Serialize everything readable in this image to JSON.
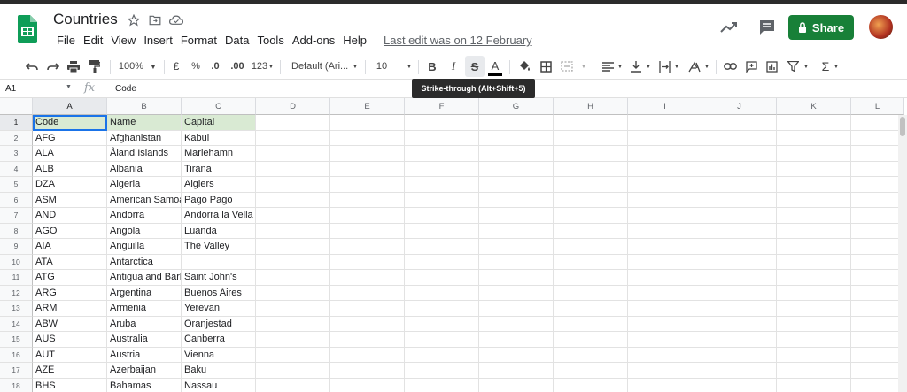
{
  "doc": {
    "title": "Countries"
  },
  "menu": [
    "File",
    "Edit",
    "View",
    "Insert",
    "Format",
    "Data",
    "Tools",
    "Add-ons",
    "Help"
  ],
  "last_edit": "Last edit was on 12 February",
  "share_label": "Share",
  "toolbar": {
    "zoom": "100%",
    "currency": "£",
    "percent": "%",
    "dec_less": ".0",
    "dec_more": ".00",
    "format": "123",
    "font": "Default (Ari...",
    "font_size": "10",
    "bold": "B",
    "italic": "I",
    "strike": "S",
    "textcolor": "A",
    "sigma": "Σ"
  },
  "tooltip": "Strike-through (Alt+Shift+5)",
  "formula_bar": {
    "cell_ref": "A1",
    "fx": "fx",
    "value": "Code"
  },
  "columns": [
    "A",
    "B",
    "C",
    "D",
    "E",
    "F",
    "G",
    "H",
    "I",
    "J",
    "K",
    "L"
  ],
  "rows": [
    [
      "Code",
      "Name",
      "Capital"
    ],
    [
      "AFG",
      "Afghanistan",
      "Kabul"
    ],
    [
      "ALA",
      "Åland Islands",
      "Mariehamn"
    ],
    [
      "ALB",
      "Albania",
      "Tirana"
    ],
    [
      "DZA",
      "Algeria",
      "Algiers"
    ],
    [
      "ASM",
      "American Samoa",
      "Pago Pago"
    ],
    [
      "AND",
      "Andorra",
      "Andorra la Vella"
    ],
    [
      "AGO",
      "Angola",
      "Luanda"
    ],
    [
      "AIA",
      "Anguilla",
      "The Valley"
    ],
    [
      "ATA",
      "Antarctica",
      ""
    ],
    [
      "ATG",
      "Antigua and Barbuda",
      "Saint John's"
    ],
    [
      "ARG",
      "Argentina",
      "Buenos Aires"
    ],
    [
      "ARM",
      "Armenia",
      "Yerevan"
    ],
    [
      "ABW",
      "Aruba",
      "Oranjestad"
    ],
    [
      "AUS",
      "Australia",
      "Canberra"
    ],
    [
      "AUT",
      "Austria",
      "Vienna"
    ],
    [
      "AZE",
      "Azerbaijan",
      "Baku"
    ],
    [
      "BHS",
      "Bahamas",
      "Nassau"
    ]
  ],
  "colors": {
    "share": "#188038",
    "header_fill": "#d9ead3",
    "selection": "#1a73e8"
  }
}
